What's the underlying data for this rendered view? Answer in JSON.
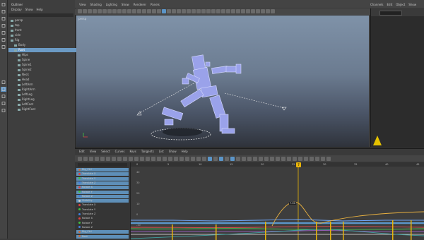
{
  "colors": {
    "selection": "#6b9ac4",
    "accent_blue": "#5b95c8",
    "current_time": "#e8b40a",
    "key_marker": "#e5c200",
    "viewport_top": "#7f92a8",
    "viewport_bottom": "#2f333b"
  },
  "toolbox": {
    "tools": [
      "select-icon",
      "move-icon",
      "rotate-icon",
      "scale-icon",
      "paint-icon",
      "lasso-icon",
      "rig-icon",
      "magnet-icon",
      "frame-icon",
      "cube-icon",
      "grid-icon",
      "layout-icon"
    ]
  },
  "outliner": {
    "title": "Outliner",
    "menu": [
      "Display",
      "Show",
      "Help"
    ],
    "rows": [
      {
        "label": "persp",
        "indent": 0,
        "selected": false
      },
      {
        "label": "top",
        "indent": 0,
        "selected": false
      },
      {
        "label": "front",
        "indent": 0,
        "selected": false
      },
      {
        "label": "side",
        "indent": 0,
        "selected": false
      },
      {
        "label": "Rig",
        "indent": 0,
        "selected": false
      },
      {
        "label": "Body",
        "indent": 1,
        "selected": false
      },
      {
        "label": "Root",
        "indent": 1,
        "selected": true
      },
      {
        "label": "Hips",
        "indent": 2,
        "selected": false
      },
      {
        "label": "Spine",
        "indent": 2,
        "selected": false
      },
      {
        "label": "Spine1",
        "indent": 2,
        "selected": false
      },
      {
        "label": "Spine2",
        "indent": 2,
        "selected": false
      },
      {
        "label": "Neck",
        "indent": 2,
        "selected": false
      },
      {
        "label": "Head",
        "indent": 2,
        "selected": false
      },
      {
        "label": "LeftArm",
        "indent": 2,
        "selected": false
      },
      {
        "label": "RightArm",
        "indent": 2,
        "selected": false
      },
      {
        "label": "LeftLeg",
        "indent": 2,
        "selected": false
      },
      {
        "label": "RightLeg",
        "indent": 2,
        "selected": false
      },
      {
        "label": "LeftFoot",
        "indent": 2,
        "selected": false
      },
      {
        "label": "RightFoot",
        "indent": 2,
        "selected": false
      }
    ]
  },
  "menubar": {
    "items": [
      "View",
      "Shading",
      "Lighting",
      "Show",
      "Renderer",
      "Panels"
    ],
    "right_items": [
      "Channels",
      "Edit",
      "Object",
      "Show"
    ]
  },
  "viewport": {
    "panel_label": "persp"
  },
  "graph_editor": {
    "menu": [
      "Edit",
      "View",
      "Select",
      "Curves",
      "Keys",
      "Tangents",
      "List",
      "Show",
      "Help"
    ],
    "channels": [
      {
        "label": "Rig_Ctrl",
        "color": "#c86b3a",
        "selected": true
      },
      {
        "label": "Translate X",
        "color": "#e04040",
        "selected": true
      },
      {
        "label": "Translate Y",
        "color": "#40c040",
        "selected": true
      },
      {
        "label": "Translate Z",
        "color": "#4080e0",
        "selected": true
      },
      {
        "label": "Rotate X",
        "color": "#e04040",
        "selected": true
      },
      {
        "label": "Rotate Y",
        "color": "#40c040",
        "selected": true
      },
      {
        "label": "Rotate Z",
        "color": "#4080e0",
        "selected": true
      },
      {
        "label": "Visibility",
        "color": "#cccccc",
        "selected": true
      },
      {
        "label": "Translate X",
        "color": "#e04040",
        "selected": false
      },
      {
        "label": "Translate Y",
        "color": "#40c040",
        "selected": false
      },
      {
        "label": "Translate Z",
        "color": "#4080e0",
        "selected": false
      },
      {
        "label": "Rotate X",
        "color": "#e04040",
        "selected": false
      },
      {
        "label": "Rotate Y",
        "color": "#40c040",
        "selected": false
      },
      {
        "label": "Rotate Z",
        "color": "#4080e0",
        "selected": false
      },
      {
        "label": "Rig_Ctrl",
        "color": "#c86b3a",
        "selected": true
      },
      {
        "label": "Root",
        "color": "#c86b3a",
        "selected": true
      }
    ],
    "ruler_frames": [
      "0",
      "5",
      "10",
      "15",
      "20",
      "25",
      "30",
      "35",
      "40",
      "45"
    ],
    "current_frame": "7",
    "frame_readout": "7.00",
    "value_labels": [
      "40",
      "30",
      "20",
      "10",
      "0",
      "-10"
    ]
  }
}
